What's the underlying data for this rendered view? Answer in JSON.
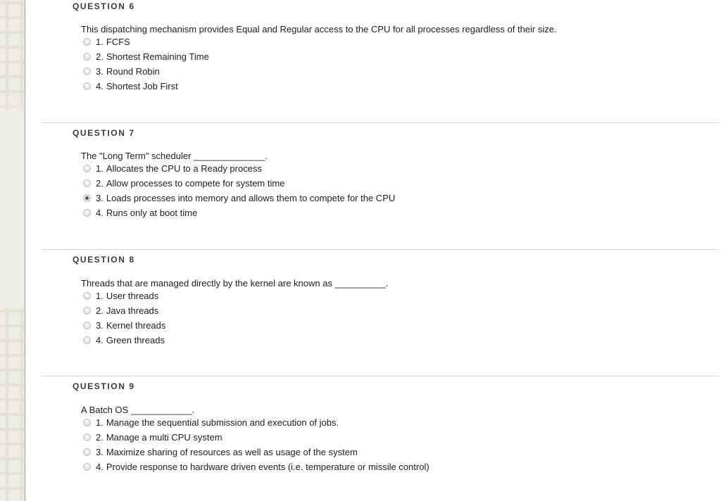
{
  "page": {
    "background": "#ffffff",
    "rail_color": "#efeee6",
    "rail_pattern_icon": "plus-pattern",
    "separator_color": "#d9d9d9",
    "text_color": "#1d1d1d",
    "header_color": "#3a3a3a",
    "radio_selected_color": "#555555"
  },
  "questions": [
    {
      "header": "QUESTION 6",
      "prompt": "This dispatching mechanism provides Equal and Regular access to the CPU for all processes regardless of their size.",
      "show_separator": false,
      "answers": [
        {
          "num": "1.",
          "label": "FCFS",
          "selected": false
        },
        {
          "num": "2.",
          "label": "Shortest Remaining Time",
          "selected": false
        },
        {
          "num": "3.",
          "label": "Round Robin",
          "selected": false
        },
        {
          "num": "4.",
          "label": "Shortest Job First",
          "selected": false
        }
      ]
    },
    {
      "header": "QUESTION 7",
      "prompt": "The \"Long Term\" scheduler ______________.",
      "show_separator": true,
      "answers": [
        {
          "num": "1.",
          "label": "Allocates the CPU to a Ready process",
          "selected": false
        },
        {
          "num": "2.",
          "label": "Allow processes to compete for system time",
          "selected": false
        },
        {
          "num": "3.",
          "label": "Loads processes into memory and allows them to compete for the CPU",
          "selected": true
        },
        {
          "num": "4.",
          "label": "Runs only at boot time",
          "selected": false
        }
      ]
    },
    {
      "header": "QUESTION 8",
      "prompt": "Threads that are managed directly by the kernel are known as __________.",
      "show_separator": true,
      "answers": [
        {
          "num": "1.",
          "label": "User threads",
          "selected": false
        },
        {
          "num": "2.",
          "label": "Java threads",
          "selected": false
        },
        {
          "num": "3.",
          "label": "Kernel threads",
          "selected": false
        },
        {
          "num": "4.",
          "label": "Green threads",
          "selected": false
        }
      ]
    },
    {
      "header": "QUESTION 9",
      "prompt": "A Batch OS ____________.",
      "show_separator": true,
      "answers": [
        {
          "num": "1.",
          "label": "Manage the sequential submission and execution of jobs.",
          "selected": false
        },
        {
          "num": "2.",
          "label": "Manage a multi CPU system",
          "selected": false
        },
        {
          "num": "3.",
          "label": "Maximize sharing of resources as well as usage of the system",
          "selected": false
        },
        {
          "num": "4.",
          "label": "Provide response to hardware driven events (i.e. temperature or missile control)",
          "selected": false
        }
      ]
    }
  ]
}
